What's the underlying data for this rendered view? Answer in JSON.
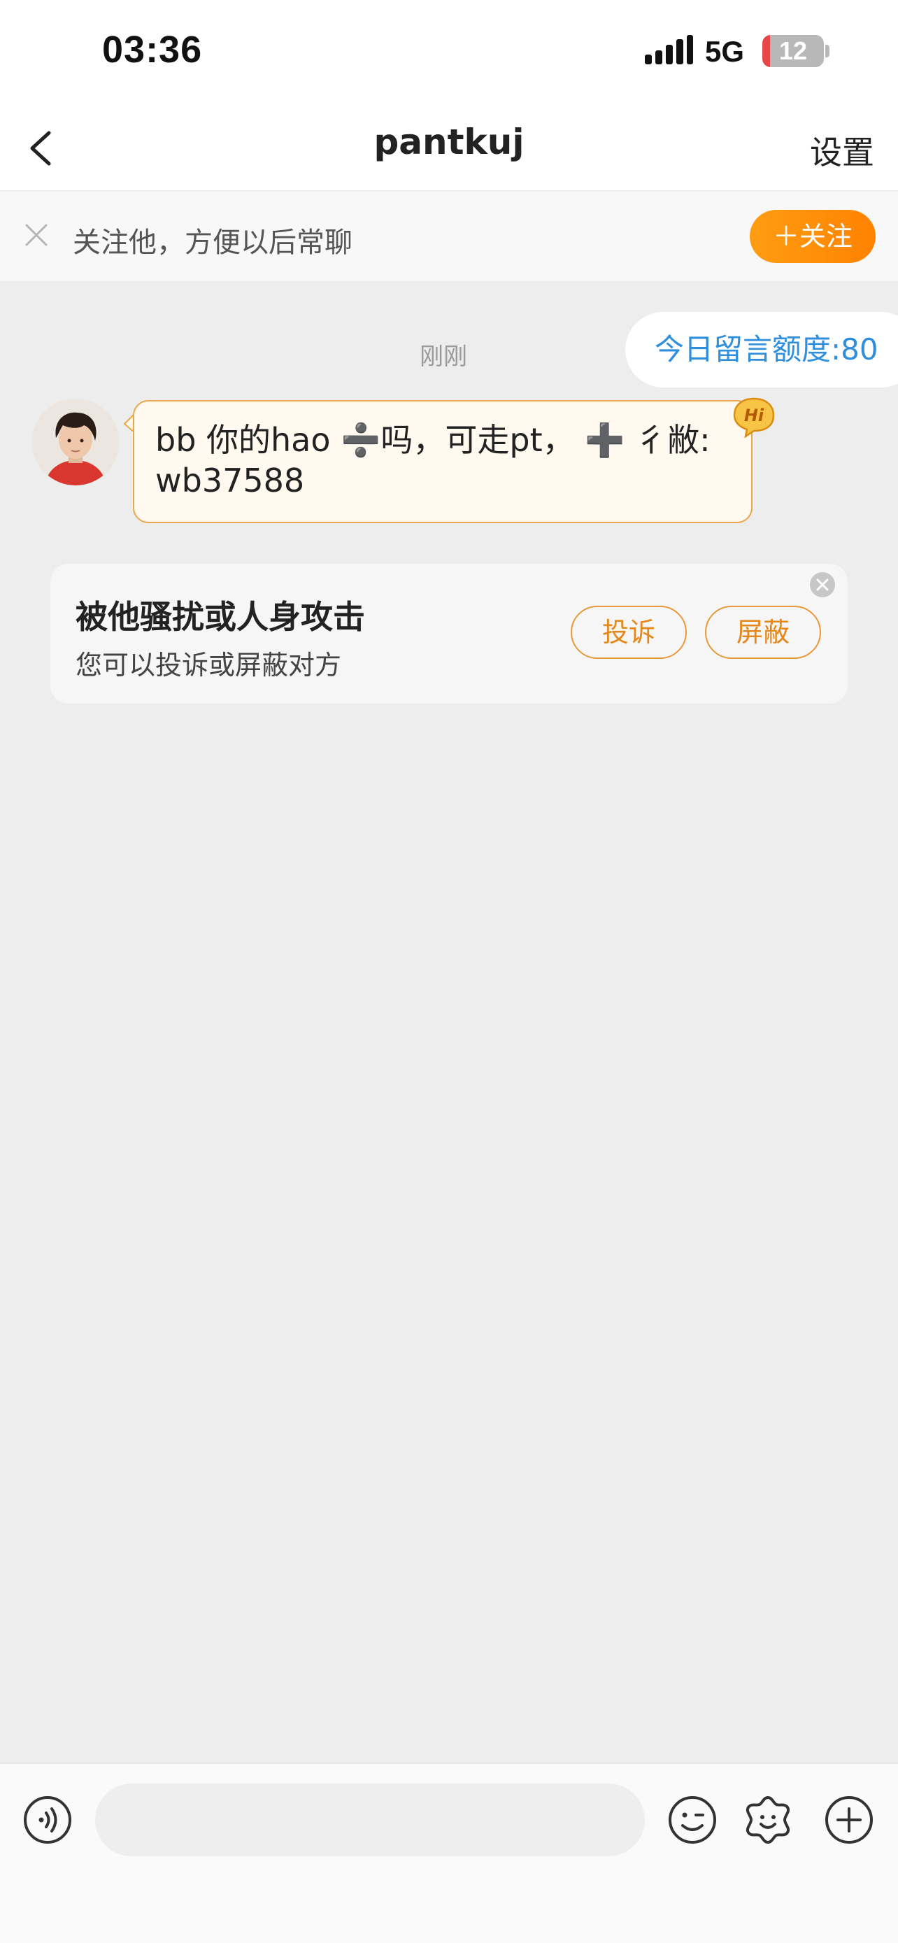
{
  "status_bar": {
    "time": "03:36",
    "network": "5G",
    "battery": "12",
    "battery_level_percent": 12,
    "battery_color": "#e8474a"
  },
  "nav": {
    "back_icon": "chevron-left-icon",
    "title": "pantkuj",
    "settings_label": "设置"
  },
  "follow_banner": {
    "text": "关注他，方便以后常聊",
    "button_label": "＋关注",
    "accent_color": "#ff8c00"
  },
  "chat": {
    "quota_label": "今日留言额度:80",
    "timestamp": "刚刚",
    "messages": [
      {
        "sender": "pantkuj",
        "text": "bb 你的hao ➗吗，可走pt， ➕ 彳敝:",
        "text_line2": "wb37588",
        "badge": "Hi"
      }
    ]
  },
  "report_card": {
    "title": "被他骚扰或人身攻击",
    "subtitle": "您可以投诉或屏蔽对方",
    "complain_label": "投诉",
    "block_label": "屏蔽",
    "accent_color": "#e5881c"
  },
  "input_bar": {
    "message_value": "",
    "icons": [
      "voice-icon",
      "emoji-icon",
      "sticker-icon",
      "plus-icon"
    ]
  }
}
